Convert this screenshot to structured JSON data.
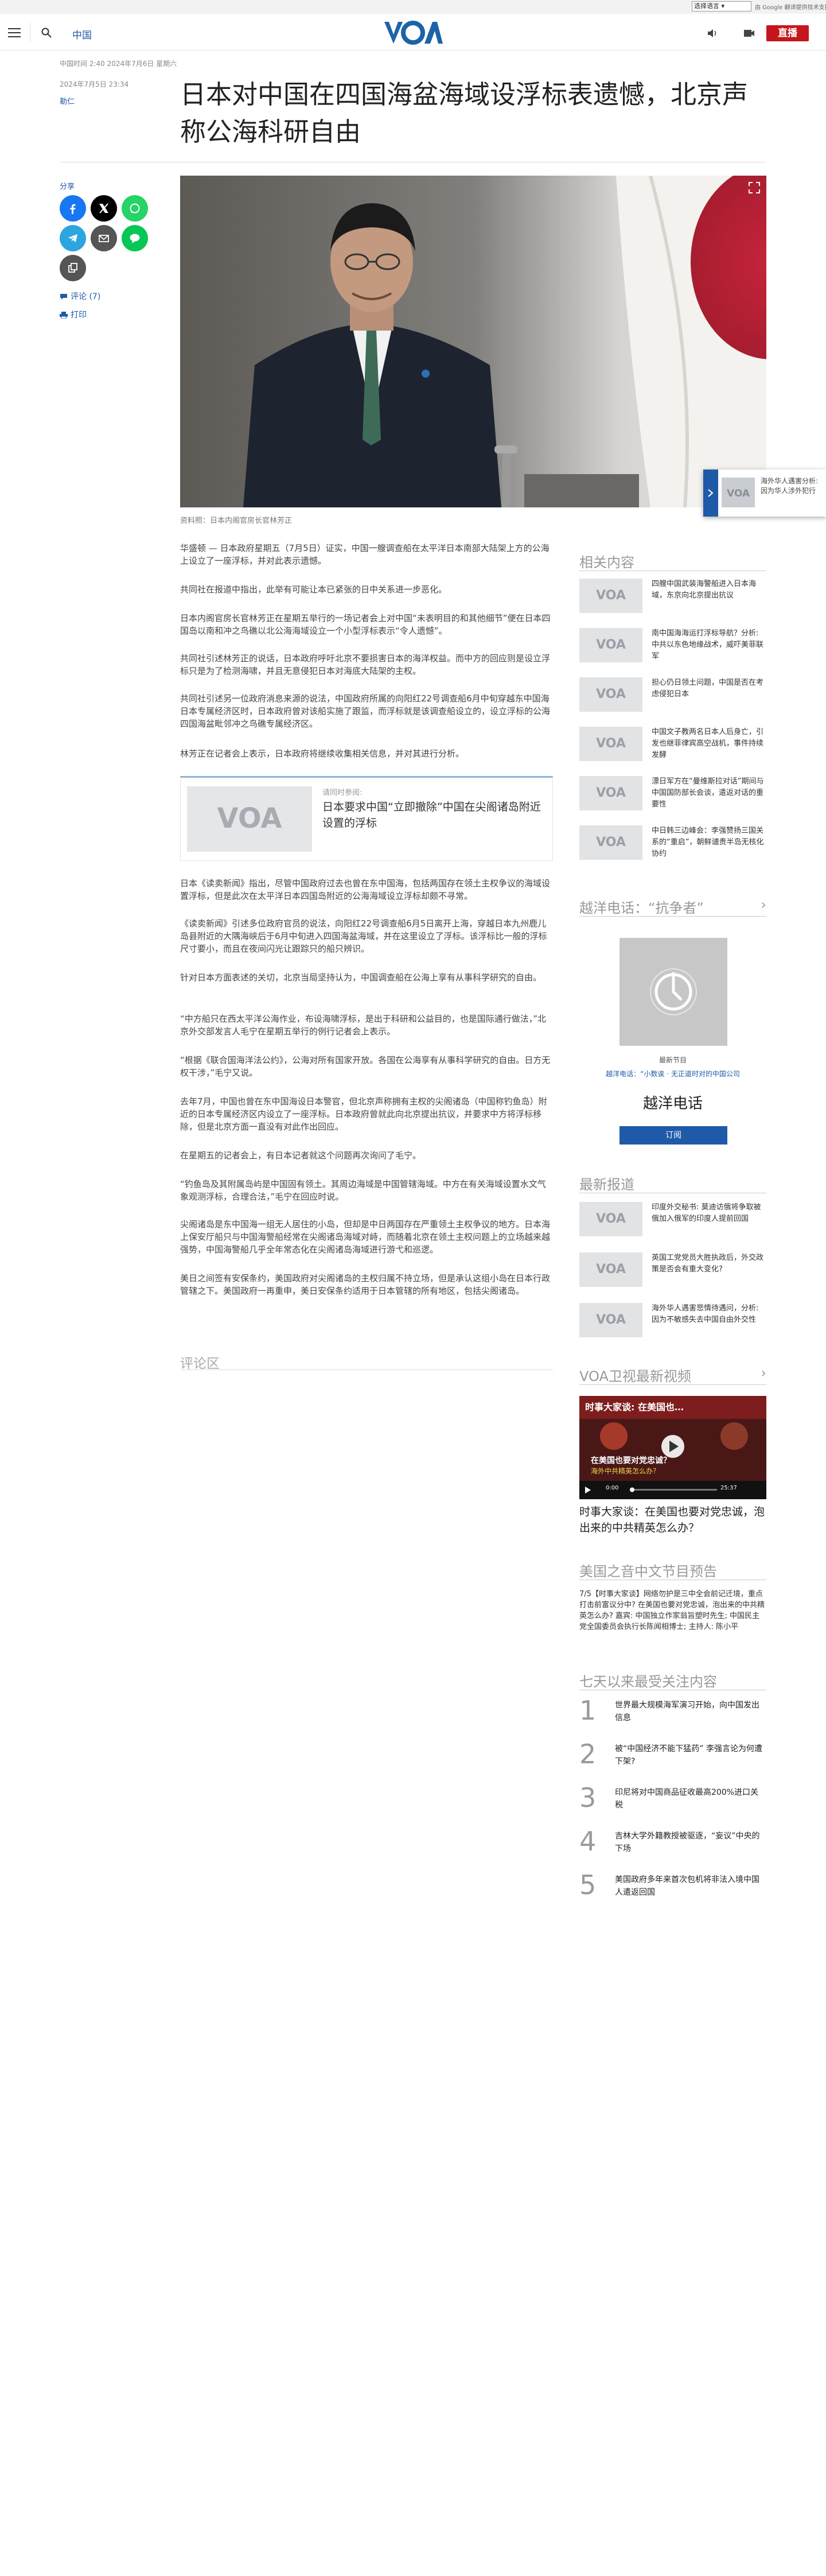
{
  "top": {
    "translate_select": "选择语言",
    "powered_by": "由 Google 翻译提供技术支持"
  },
  "nav": {
    "section": "中国",
    "logo_text": "VOA",
    "live": "直播"
  },
  "article": {
    "dateline": "中国时间 2:40 2024年7月6日 星期六",
    "published": "2024年7月5日 23:34",
    "author": "勒仁",
    "headline": "日本对中国在四国海盆海域设浮标表遗憾，北京声称公海科研自由",
    "share_label": "分享",
    "comments_link": "评论 (7)",
    "print_link": "打印",
    "caption": "资料照：日本内阁官房长官林芳正",
    "paragraphs": [
      "华盛顿 — 日本政府星期五（7月5日）证实，中国一艘调查船在太平洋日本南部大陆架上方的公海上设立了一座浮标，并对此表示遗憾。",
      "共同社在报道中指出，此举有可能让本已紧张的日中关系进一步恶化。",
      "日本内阁官房长官林芳正在星期五举行的一场记者会上对中国“未表明目的和其他细节”便在日本四国岛以南和冲之鸟礁以北公海海域设立一个小型浮标表示“令人遗憾”。",
      "共同社引述林芳正的说话，日本政府呼吁北京不要损害日本的海洋权益。而中方的回应则是设立浮标只是为了检测海啸，并且无意侵犯日本对海底大陆架的主权。",
      "共同社引述另一位政府消息来源的说法，中国政府所属的向阳红22号调查船6月中旬穿越东中国海日本专属经济区时，日本政府曾对该船实施了跟监，而浮标就是该调查船设立的，设立浮标的公海四国海盆毗邻冲之鸟礁专属经济区。",
      "林芳正在记者会上表示，日本政府将继续收集相关信息，并对其进行分析。",
      "日本《读卖新闻》指出，尽管中国政府过去也曾在东中国海，包括两国存在领土主权争议的海域设置浮标，但是此次在太平洋日本四国岛附近的公海海域设立浮标却颇不寻常。",
      "《读卖新闻》引述多位政府官员的说法，向阳红22号调查船6月5日离开上海，穿越日本九州鹿儿岛县附近的大隅海峡后于6月中旬进入四国海盆海域，并在这里设立了浮标。该浮标比一般的浮标尺寸要小，而且在夜间闪光让跟踪只的船只辨识。",
      "针对日本方面表述的关切，北京当局坚持认为，中国调查船在公海上享有从事科学研究的自由。",
      "“中方船只在西太平洋公海作业，布设海啸浮标，是出于科研和公益目的，也是国际通行做法，”北京外交部发言人毛宁在星期五举行的例行记者会上表示。",
      "“根据《联合国海洋法公约》，公海对所有国家开放。各国在公海享有从事科学研究的自由。日方无权干涉，”毛宁又说。",
      "去年7月，中国也曾在东中国海设日本警官，但北京声称拥有主权的尖阁诸岛（中国称钓鱼岛）附近的日本专属经济区内设立了一座浮标。日本政府曾就此向北京提出抗议，并要求中方将浮标移除，但是北京方面一直没有对此作出回应。",
      "在星期五的记者会上，有日本记者就这个问题再次询问了毛宁。",
      "“钓鱼岛及其附属岛屿是中国固有领土。其周边海域是中国管辖海域。中方在有关海域设置水文气象观测浮标，合理合法，”毛宁在回应时说。",
      "尖阁诸岛是东中国海一组无人居住的小岛，但却是中日两国存在严重领土主权争议的地方。日本海上保安厅船只与中国海警船经常在尖阁诸岛海域对峙，而随着北京在领土主权问题上的立场越来越强势，中国海警船几乎全年常态化在尖阁诸岛海域进行游弋和巡逻。",
      "美日之间签有安保条约，美国政府对尖阁诸岛的主权归属不持立场，但是承认这组小岛在日本行政管辖之下。美国政府一再重申，美日安保条约适用于日本管辖的所有地区，包括尖阁诸岛。"
    ],
    "related": {
      "label": "请同时参阅:",
      "title": "日本要求中国“立即撤除”中国在尖阁诸岛附近设置的浮标"
    },
    "comments_heading": "评论区"
  },
  "popup": {
    "text": "海外华人遇害分析: 因为华人涉外犯行"
  },
  "sidebar": {
    "related_heading": "相关内容",
    "related_items": [
      "四艘中国武装海警船进入日本海域，东京向北京提出抗议",
      "南中国海海运打浮标导航？分析: 中共以东色地缘战术，威吓美菲联军",
      "担心仍日领土问题，中国是否在考虑侵犯日本",
      "中国文子教两名日本人后身亡，引发也继菲律宾高空战机，事件持续发酵",
      "漂日军方在“曼维斯拉对话”期间与中国国防部长会谈，遣返对话的重要性",
      "中日韩三边峰会：李强赞扬三国关系的“重启”，朝鲜谴责半岛无核化协约"
    ],
    "podcast_heading": "越洋电话：“抗争者”",
    "podcast_when": "最新节目",
    "podcast_sub": "越洋电话：“小数诶 · 无正道时对的中国公司",
    "podcast_name": "越洋电话",
    "podcast_subscribe": "订阅",
    "latest_heading": "最新报道",
    "latest_items": [
      "印度外交秘书: 莫迪访俄将争取被俄加入俄军的印度人提前回国",
      "英国工党党员大胜执政后，外交政策是否会有重大变化?",
      "海外华人遇害悲情待遇问，分析: 因为不敏感失去中国自由外交性"
    ],
    "video_heading": "VOA卫视最新视频",
    "video_overlay_top": "时事大家谈: 在美国也…",
    "video_overlay_mid": "在美国也要对党忠诚？",
    "video_overlay_sub": "海外中共精英怎么办？",
    "video_time_cur": "0:00",
    "video_time_total": "25:37",
    "video_title": "时事大家谈：在美国也要对党忠诚，泡出来的中共精英怎么办？",
    "schedule_heading": "美国之音中文节目预告",
    "schedule_text": "7/5【时事大家谈】网络勿护是三中全会前记迁境，重点打击前富议分中? 在美国也要对党忠诚，泡出来的中共精英怎么办? 嘉宾: 中国独立作家翁旨塑时先生; 中国民主党全国委员会执行长陈闻相博士; 主持人: 陈小平",
    "popular_heading": "七天以来最受关注内容",
    "popular_items": [
      {
        "num": "1",
        "text": "世界最大规模海军演习开始，向中国发出信息"
      },
      {
        "num": "2",
        "text": "被“中国经济不能下猛药” 李强言论为何遭下架?"
      },
      {
        "num": "3",
        "text": "印尼将对中国商品征收最高200%进口关税"
      },
      {
        "num": "4",
        "text": "吉林大学外籍教授被驱逐，“妄议”中央的下场"
      },
      {
        "num": "5",
        "text": "美国政府多年来首次包机将非法入境中国人遣返回国"
      }
    ]
  },
  "colors": {
    "brand_blue": "#1e5aa8",
    "live_red": "#c4161c",
    "logo_blue": "#1c64a8"
  },
  "icons": [
    "menu-icon",
    "search-icon",
    "radio-icon",
    "tv-icon",
    "facebook-icon",
    "x-icon",
    "whatsapp-icon",
    "telegram-icon",
    "email-icon",
    "line-icon",
    "copy-link-icon",
    "comment-icon",
    "print-icon",
    "expand-icon",
    "chevron-right-icon",
    "play-icon"
  ]
}
